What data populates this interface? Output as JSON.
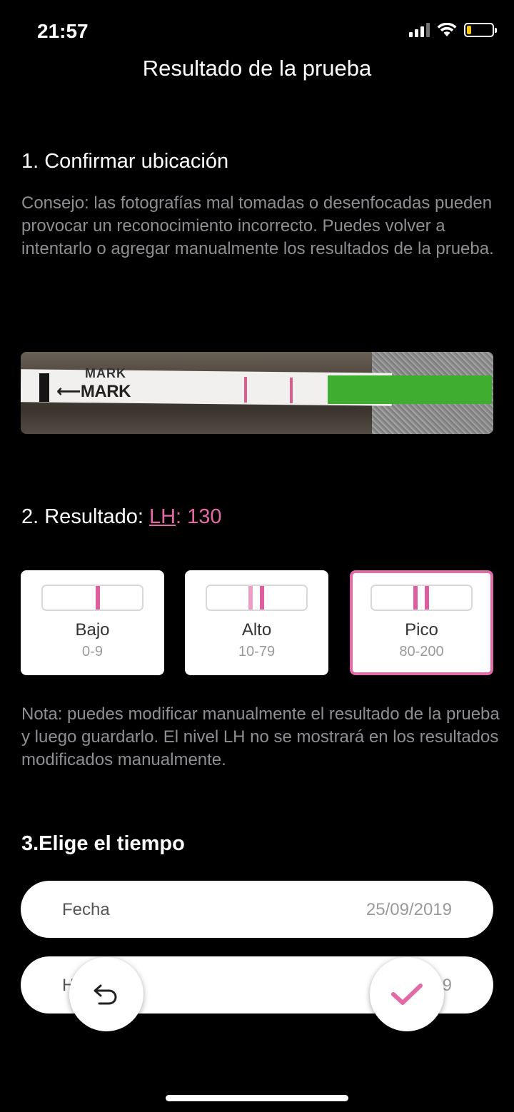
{
  "status_bar": {
    "time": "21:57",
    "battery_color": "#f5c518"
  },
  "header": {
    "title": "Resultado de la prueba"
  },
  "section1": {
    "title": "1. Confirmar ubicación",
    "tip": "Consejo: las fotografías mal tomadas o desenfocadas pueden provocar un reconocimiento incorrecto. Puedes volver a intentarlo o agregar manualmente los resultados de la prueba.",
    "strip_text": "MARK",
    "strip_text_top": "MARK"
  },
  "section2": {
    "title_prefix": "2. Resultado: ",
    "lh_link": "LH",
    "lh_value": ": 130",
    "accent_color": "#e36aa4",
    "levels": [
      {
        "label": "Bajo",
        "range": "0-9",
        "selected": false
      },
      {
        "label": "Alto",
        "range": "10-79",
        "selected": false
      },
      {
        "label": "Pico",
        "range": "80-200",
        "selected": true
      }
    ],
    "note": "Nota: puedes modificar manualmente el resultado de la prueba y luego guardarlo. El nivel LH no se mostrará en los resultados modificados manualmente."
  },
  "section3": {
    "title": "3.Elige el tiempo",
    "date_label": "Fecha",
    "date_value": "25/09/2019",
    "time_label_visible": "H",
    "time_value_visible": "9"
  },
  "actions": {
    "back_icon": "undo-arrow-icon",
    "confirm_icon": "checkmark-icon"
  }
}
